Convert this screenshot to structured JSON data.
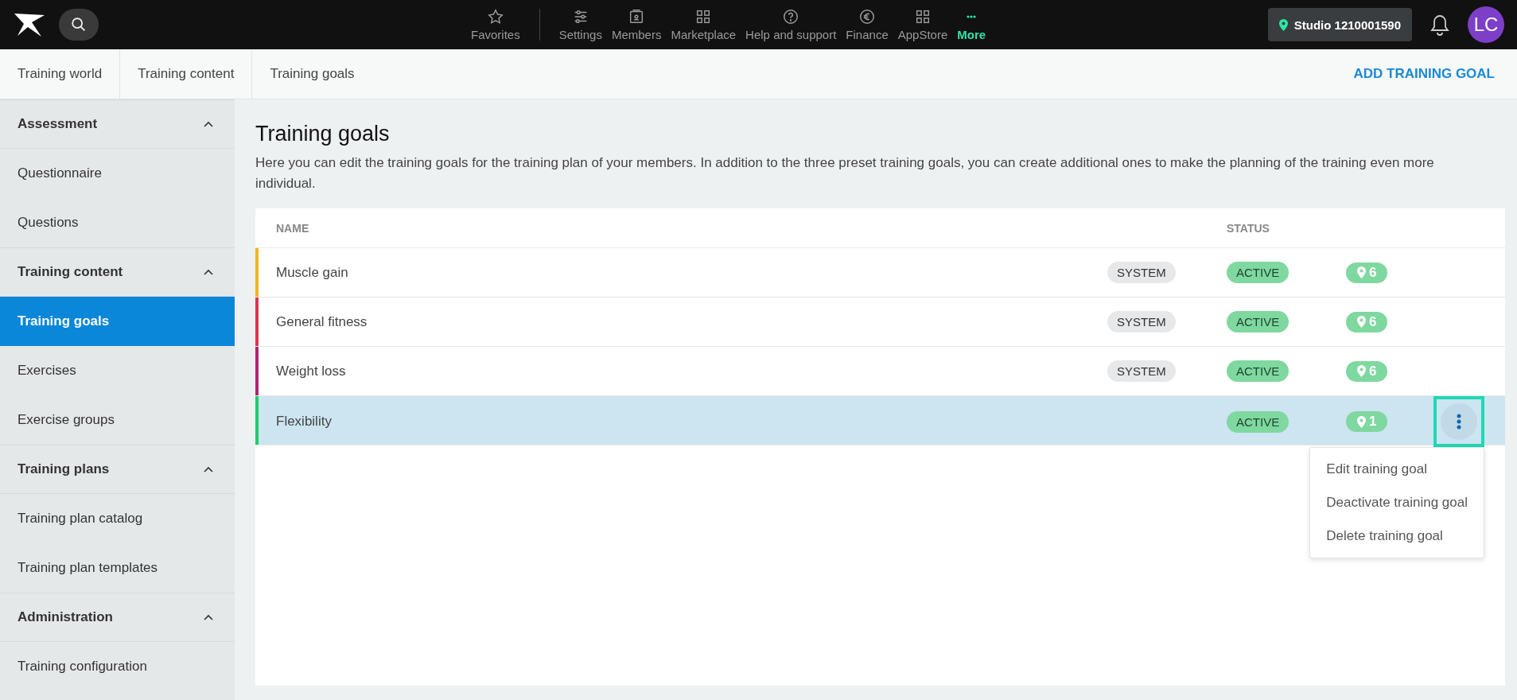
{
  "topbar": {
    "nav": [
      {
        "label": "Favorites",
        "selected": false
      },
      {
        "label": "Settings",
        "selected": false
      },
      {
        "label": "Members",
        "selected": false
      },
      {
        "label": "Marketplace",
        "selected": false
      },
      {
        "label": "Help and support",
        "selected": false
      },
      {
        "label": "Finance",
        "selected": false
      },
      {
        "label": "AppStore",
        "selected": false
      },
      {
        "label": "More",
        "selected": true
      }
    ],
    "studio": "Studio 1210001590",
    "avatar": "LC"
  },
  "breadcrumbs": [
    "Training world",
    "Training content",
    "Training goals"
  ],
  "add_button": "ADD TRAINING GOAL",
  "sidebar": [
    {
      "title": "Assessment",
      "expanded": true,
      "items": [
        {
          "label": "Questionnaire",
          "selected": false
        },
        {
          "label": "Questions",
          "selected": false
        }
      ]
    },
    {
      "title": "Training content",
      "expanded": true,
      "items": [
        {
          "label": "Training goals",
          "selected": true
        },
        {
          "label": "Exercises",
          "selected": false
        },
        {
          "label": "Exercise groups",
          "selected": false
        }
      ]
    },
    {
      "title": "Training plans",
      "expanded": true,
      "items": [
        {
          "label": "Training plan catalog",
          "selected": false
        },
        {
          "label": "Training plan templates",
          "selected": false
        }
      ]
    },
    {
      "title": "Administration",
      "expanded": true,
      "items": [
        {
          "label": "Training configuration",
          "selected": false
        }
      ]
    }
  ],
  "page": {
    "title": "Training goals",
    "description": "Here you can edit the training goals for the training plan of your members. In addition to the three preset training goals, you can create additional ones to make the planning of the training even more individual."
  },
  "table": {
    "columns": [
      "NAME",
      "STATUS"
    ],
    "rows": [
      {
        "name": "Muscle gain",
        "color": "#f2b51f",
        "system": "SYSTEM",
        "status": "ACTIVE",
        "locations": "6",
        "selected": false
      },
      {
        "name": "General fitness",
        "color": "#e0334f",
        "system": "SYSTEM",
        "status": "ACTIVE",
        "locations": "6",
        "selected": false
      },
      {
        "name": "Weight loss",
        "color": "#b0246f",
        "system": "SYSTEM",
        "status": "ACTIVE",
        "locations": "6",
        "selected": false
      },
      {
        "name": "Flexibility",
        "color": "#1ccf6a",
        "status": "ACTIVE",
        "locations": "1",
        "selected": true,
        "menu_open": true
      }
    ]
  },
  "row_menu": [
    "Edit training goal",
    "Deactivate training goal",
    "Delete training goal"
  ]
}
